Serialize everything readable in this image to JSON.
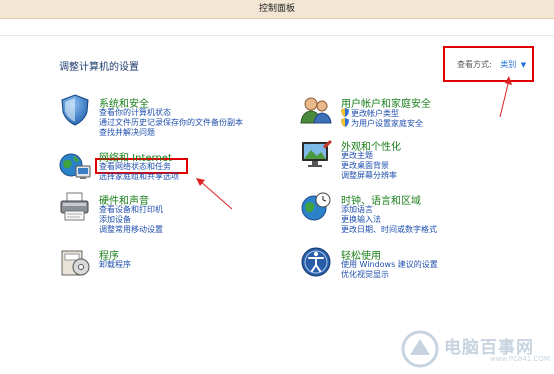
{
  "window": {
    "title": "控制面板"
  },
  "header": {
    "page_title": "调整计算机的设置",
    "view_label": "查看方式:",
    "view_value": "类别"
  },
  "categories": {
    "system": {
      "title": "系统和安全",
      "links": [
        "查看你的计算机状态",
        "通过文件历史记录保存你的文件备份副本",
        "查找并解决问题"
      ]
    },
    "network": {
      "title": "网络和 Internet",
      "links": [
        "查看网络状态和任务",
        "选择家庭组和共享选项"
      ]
    },
    "hardware": {
      "title": "硬件和声音",
      "links": [
        "查看设备和打印机",
        "添加设备",
        "调整常用移动设置"
      ]
    },
    "programs": {
      "title": "程序",
      "links": [
        "卸载程序"
      ]
    },
    "accounts": {
      "title": "用户帐户和家庭安全",
      "links": [
        "更改帐户类型",
        "为用户设置家庭安全"
      ]
    },
    "appearance": {
      "title": "外观和个性化",
      "links": [
        "更改主题",
        "更改桌面背景",
        "调整屏幕分辨率"
      ]
    },
    "clock": {
      "title": "时钟、语言和区域",
      "links": [
        "添加语言",
        "更换输入法",
        "更改日期、时间或数字格式"
      ]
    },
    "ease": {
      "title": "轻松使用",
      "links": [
        "使用 Windows 建议的设置",
        "优化视觉显示"
      ]
    }
  },
  "watermark": {
    "text": "电脑百事网",
    "url": "www.PC841.COM"
  },
  "colors": {
    "category_title": "#1a7f1a",
    "link": "#1f4fae",
    "highlight": "#e00000"
  }
}
